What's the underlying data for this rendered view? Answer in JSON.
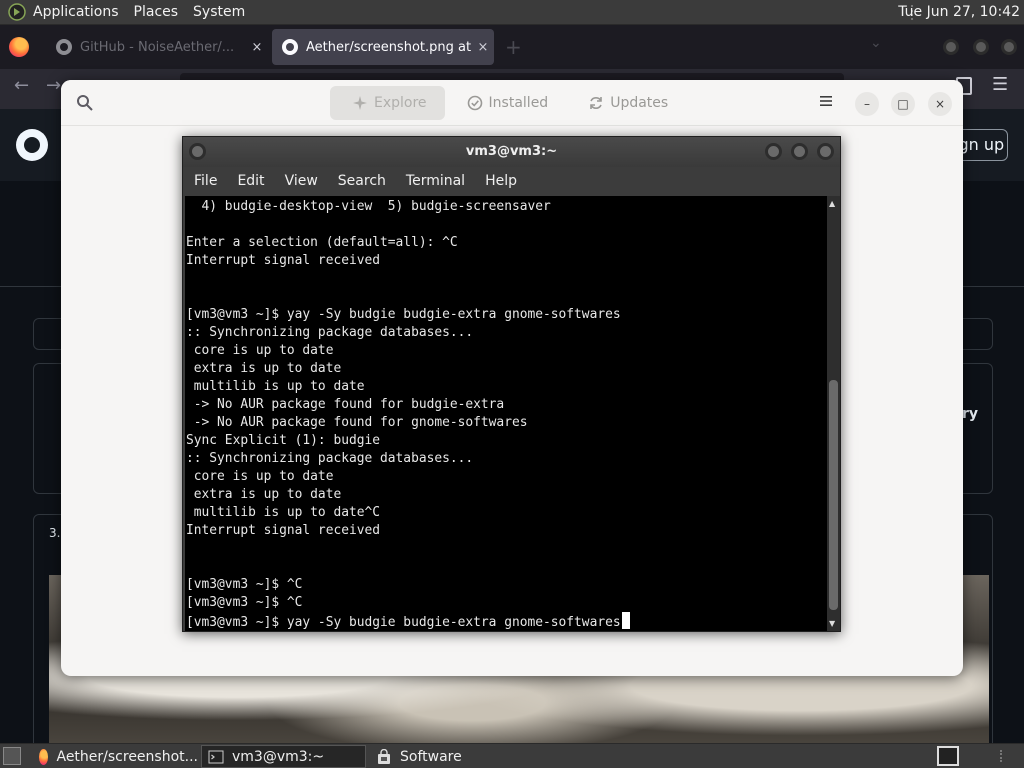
{
  "top_panel": {
    "menus": [
      "Applications",
      "Places",
      "System"
    ],
    "clock": "Tue Jun 27, 10:42"
  },
  "browser": {
    "tabs": [
      {
        "title": "GitHub - NoiseAether/..."
      },
      {
        "title": "Aether/screenshot.png at s"
      }
    ],
    "signup_label": "Sign up",
    "partial_text_right": "ry",
    "partial_number": "3."
  },
  "software": {
    "tabs": [
      {
        "label": "Explore",
        "icon": "explore-icon"
      },
      {
        "label": "Installed",
        "icon": "installed-check-icon"
      },
      {
        "label": "Updates",
        "icon": "updates-refresh-icon"
      }
    ],
    "window_buttons": {
      "minimize": "–",
      "maximize": "□",
      "close": "×"
    }
  },
  "terminal": {
    "title": "vm3@vm3:~",
    "menu": [
      "File",
      "Edit",
      "View",
      "Search",
      "Terminal",
      "Help"
    ],
    "lines": [
      "  4) budgie-desktop-view  5) budgie-screensaver",
      "",
      "Enter a selection (default=all): ^C",
      "Interrupt signal received",
      "",
      "",
      "[vm3@vm3 ~]$ yay -Sy budgie budgie-extra gnome-softwares",
      ":: Synchronizing package databases...",
      " core is up to date",
      " extra is up to date",
      " multilib is up to date",
      " -> No AUR package found for budgie-extra",
      " -> No AUR package found for gnome-softwares",
      "Sync Explicit (1): budgie",
      ":: Synchronizing package databases...",
      " core is up to date",
      " extra is up to date",
      " multilib is up to date^C",
      "Interrupt signal received",
      "",
      "",
      "[vm3@vm3 ~]$ ^C",
      "[vm3@vm3 ~]$ ^C"
    ],
    "current_line": "[vm3@vm3 ~]$ yay -Sy budgie budgie-extra gnome-softwares"
  },
  "bottom_panel": {
    "tasks": [
      {
        "label": "Aether/screenshot...",
        "icon": "firefox-icon"
      },
      {
        "label": "vm3@vm3:~",
        "icon": "terminal-icon"
      },
      {
        "label": "Software",
        "icon": "software-bag-icon"
      }
    ]
  }
}
